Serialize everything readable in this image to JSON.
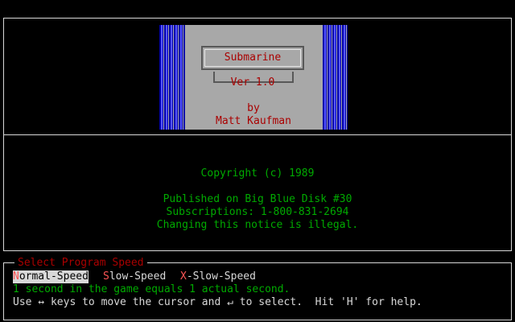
{
  "title_card": {
    "title": "Submarine",
    "version": "Ver 1.0",
    "by": "by",
    "author": "Matt Kaufman"
  },
  "info": {
    "copyright": "Copyright (c) 1989",
    "published": "Published on Big Blue Disk #30",
    "subscriptions": "Subscriptions: 1-800-831-2694",
    "notice": "Changing this notice is illegal."
  },
  "speed_menu": {
    "heading": "Select Program Speed",
    "options": [
      {
        "hotkey": "N",
        "rest": "ormal-Speed",
        "selected": true
      },
      {
        "hotkey": "S",
        "rest": "low-Speed",
        "selected": false
      },
      {
        "hotkey": "X",
        "rest": "-Slow-Speed",
        "selected": false
      }
    ],
    "description": "1 second in the game equals 1 actual second.",
    "help": "Use ↔ keys to move the cursor and ↵ to select.  Hit 'H' for help."
  },
  "colors": {
    "red": "#aa0000",
    "green": "#00aa00",
    "hotkey": "#ff5555",
    "text": "#d8d8d8",
    "card": "#a8a8a8",
    "stripe": "#0000aa"
  }
}
